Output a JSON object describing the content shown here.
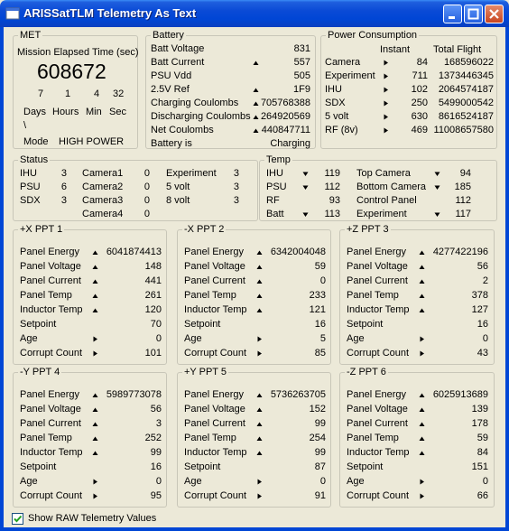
{
  "window": {
    "title": "ARISSatTLM Telemetry As Text"
  },
  "met": {
    "legend": "MET",
    "label": "Mission Elapsed Time (sec)",
    "value": "608672",
    "days": "7",
    "hours": "1",
    "min": "4",
    "sec": "32",
    "days_label": "Days",
    "hours_label": "Hours",
    "min_label": "Min",
    "sec_label": "Sec",
    "slash": "\\",
    "mode_label": "Mode",
    "mode_value": "HIGH POWER"
  },
  "battery": {
    "legend": "Battery",
    "rows": [
      {
        "label": "Batt Voltage",
        "value": "831",
        "arrow": "none"
      },
      {
        "label": "Batt Current",
        "value": "557",
        "arrow": "up"
      },
      {
        "label": "PSU Vdd",
        "value": "505",
        "arrow": "none"
      },
      {
        "label": "2.5V Ref",
        "value": "1F9",
        "arrow": "up"
      },
      {
        "label": "Charging Coulombs",
        "value": "705768388",
        "arrow": "up"
      },
      {
        "label": "Discharging Coulombs",
        "value": "264920569",
        "arrow": "up"
      },
      {
        "label": "Net Coulombs",
        "value": "440847711",
        "arrow": "up"
      },
      {
        "label": "Battery is",
        "value": "Charging",
        "arrow": "none"
      }
    ]
  },
  "power": {
    "legend": "Power Consumption",
    "instant_label": "Instant",
    "total_label": "Total Flight",
    "rows": [
      {
        "label": "Camera",
        "instant": "84",
        "total": "168596022"
      },
      {
        "label": "Experiment",
        "instant": "711",
        "total": "1373446345"
      },
      {
        "label": "IHU",
        "instant": "102",
        "total": "2064574187"
      },
      {
        "label": "SDX",
        "instant": "250",
        "total": "5499000542"
      },
      {
        "label": "5 volt",
        "instant": "630",
        "total": "8616524187"
      },
      {
        "label": "RF (8v)",
        "instant": "469",
        "total": "11008657580"
      }
    ]
  },
  "status": {
    "legend": "Status",
    "col1": [
      {
        "label": "IHU",
        "value": "3"
      },
      {
        "label": "PSU",
        "value": "6"
      },
      {
        "label": "SDX",
        "value": "3"
      }
    ],
    "col2": [
      {
        "label": "Camera1",
        "value": "0"
      },
      {
        "label": "Camera2",
        "value": "0"
      },
      {
        "label": "Camera3",
        "value": "0"
      },
      {
        "label": "Camera4",
        "value": "0"
      }
    ],
    "col3": [
      {
        "label": "Experiment",
        "value": "3"
      },
      {
        "label": "5 volt",
        "value": "3"
      },
      {
        "label": "8 volt",
        "value": "3"
      }
    ]
  },
  "temp": {
    "legend": "Temp",
    "col1": [
      {
        "label": "IHU",
        "value": "119",
        "arrow": "down"
      },
      {
        "label": "PSU",
        "value": "112",
        "arrow": "down"
      },
      {
        "label": "RF",
        "value": "93",
        "arrow": "none"
      },
      {
        "label": "Batt",
        "value": "113",
        "arrow": "down"
      }
    ],
    "col2": [
      {
        "label": "Top Camera",
        "value": "94",
        "arrow": "down"
      },
      {
        "label": "Bottom Camera",
        "value": "185",
        "arrow": "down"
      },
      {
        "label": "Control Panel",
        "value": "112",
        "arrow": "none"
      },
      {
        "label": "Experiment",
        "value": "117",
        "arrow": "down"
      }
    ]
  },
  "ppt_labels": [
    "Panel Energy",
    "Panel Voltage",
    "Panel Current",
    "Panel Temp",
    "Inductor Temp",
    "Setpoint",
    "Age",
    "Corrupt Count"
  ],
  "ppts": [
    {
      "legend": "+X PPT 1",
      "values": [
        "6041874413",
        "148",
        "441",
        "261",
        "120",
        "70",
        "0",
        "101"
      ],
      "arrows": [
        "up",
        "up",
        "up",
        "up",
        "up",
        "none",
        "right",
        "right"
      ]
    },
    {
      "legend": "-X PPT 2",
      "values": [
        "6342004048",
        "59",
        "0",
        "233",
        "121",
        "16",
        "5",
        "85"
      ],
      "arrows": [
        "up",
        "up",
        "up",
        "up",
        "up",
        "none",
        "right",
        "right"
      ]
    },
    {
      "legend": "+Z PPT 3",
      "values": [
        "4277422196",
        "56",
        "2",
        "378",
        "127",
        "16",
        "0",
        "43"
      ],
      "arrows": [
        "up",
        "up",
        "up",
        "up",
        "up",
        "none",
        "right",
        "right"
      ]
    },
    {
      "legend": "-Y PPT 4",
      "values": [
        "5989773078",
        "56",
        "3",
        "252",
        "99",
        "16",
        "0",
        "95"
      ],
      "arrows": [
        "up",
        "up",
        "up",
        "up",
        "up",
        "none",
        "right",
        "right"
      ]
    },
    {
      "legend": "+Y PPT 5",
      "values": [
        "5736263705",
        "152",
        "99",
        "254",
        "99",
        "87",
        "0",
        "91"
      ],
      "arrows": [
        "up",
        "up",
        "up",
        "up",
        "up",
        "none",
        "right",
        "right"
      ]
    },
    {
      "legend": "-Z PPT 6",
      "values": [
        "6025913689",
        "139",
        "178",
        "59",
        "84",
        "151",
        "0",
        "66"
      ],
      "arrows": [
        "up",
        "up",
        "up",
        "up",
        "up",
        "none",
        "right",
        "right"
      ]
    }
  ],
  "footer": {
    "raw_label": "Show RAW Telemetry Values",
    "raw_checked": true
  }
}
